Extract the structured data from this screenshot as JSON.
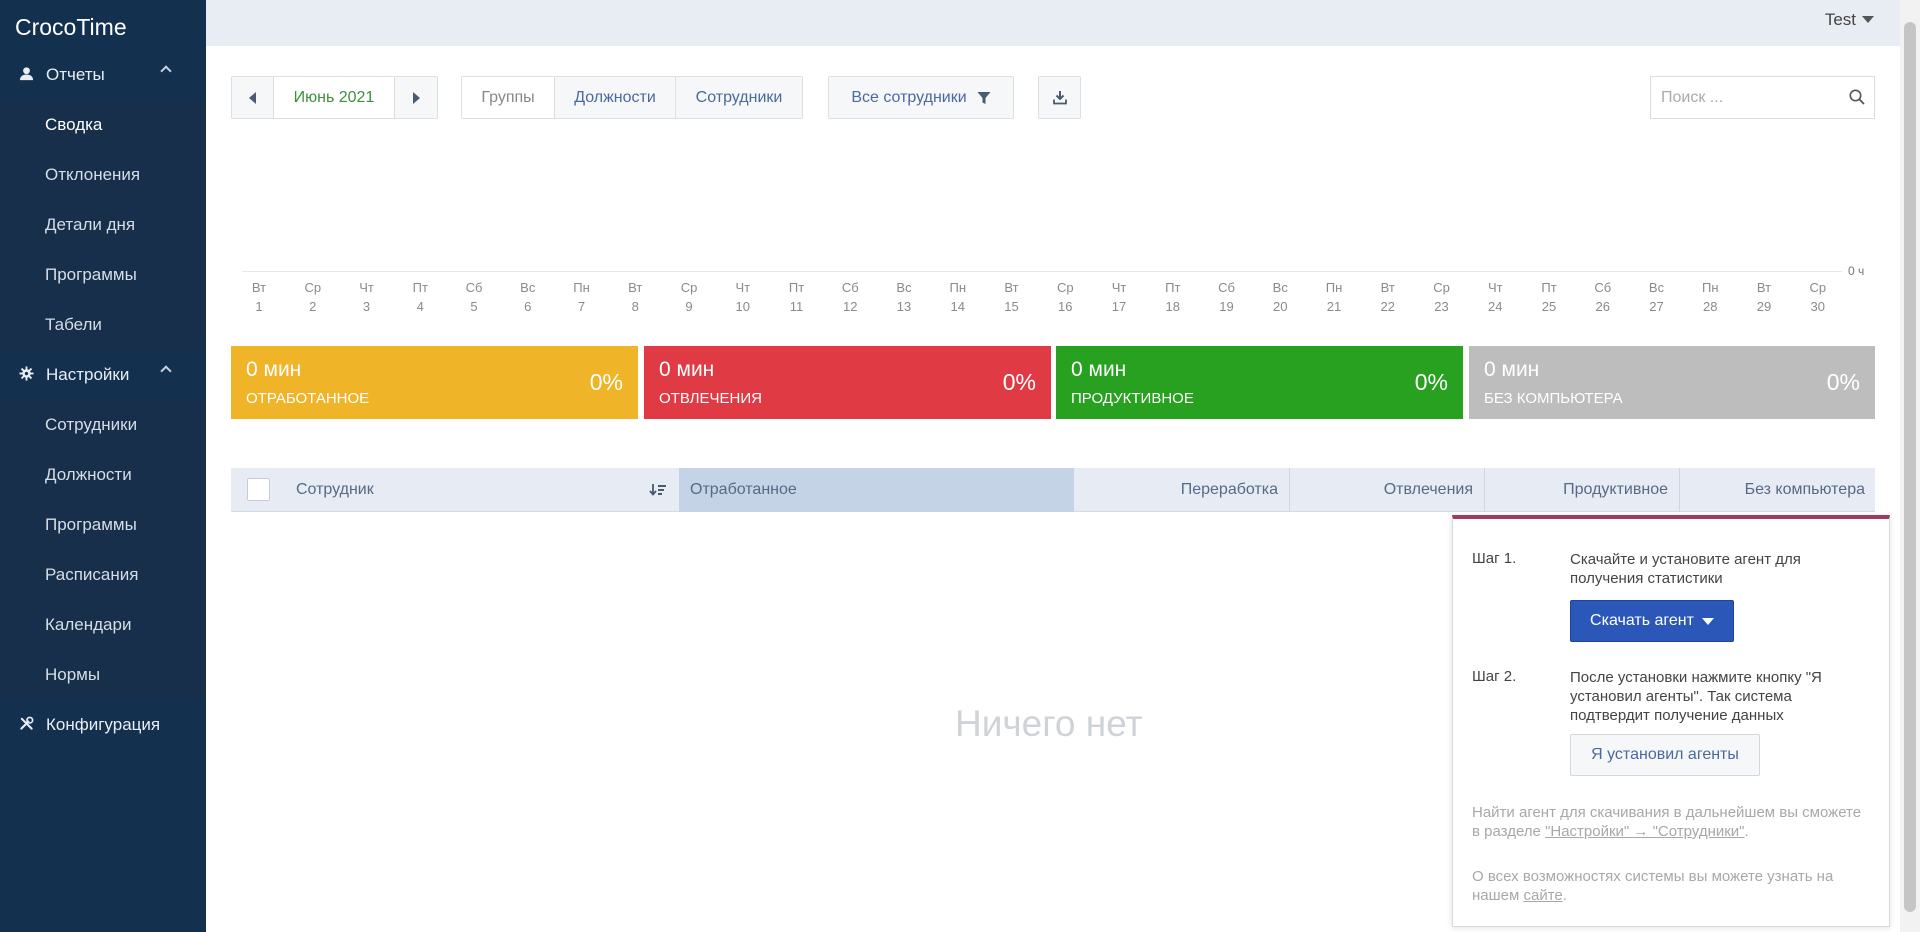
{
  "app": {
    "title": "CrocoTime"
  },
  "sidebar": {
    "reports": {
      "label": "Отчеты",
      "icon": "user-icon"
    },
    "report_items": [
      {
        "label": "Сводка",
        "active": true
      },
      {
        "label": "Отклонения"
      },
      {
        "label": "Детали дня"
      },
      {
        "label": "Программы"
      },
      {
        "label": "Табели"
      }
    ],
    "settings": {
      "label": "Настройки",
      "icon": "gear-icon"
    },
    "settings_items": [
      {
        "label": "Сотрудники"
      },
      {
        "label": "Должности"
      },
      {
        "label": "Программы"
      },
      {
        "label": "Расписания"
      },
      {
        "label": "Календари"
      },
      {
        "label": "Нормы"
      }
    ],
    "config": {
      "label": "Конфигурация",
      "icon": "tools-icon"
    }
  },
  "header": {
    "user": "Test"
  },
  "toolbar": {
    "month": "Июнь 2021",
    "view_groups": "Группы",
    "view_positions": "Должности",
    "view_employees": "Сотрудники",
    "filter": "Все сотрудники",
    "search_placeholder": "Поиск ..."
  },
  "timeline": {
    "zero_label": "0 ч",
    "days": [
      {
        "wd": "Вт",
        "d": "1"
      },
      {
        "wd": "Ср",
        "d": "2"
      },
      {
        "wd": "Чт",
        "d": "3"
      },
      {
        "wd": "Пт",
        "d": "4"
      },
      {
        "wd": "Сб",
        "d": "5"
      },
      {
        "wd": "Вс",
        "d": "6"
      },
      {
        "wd": "Пн",
        "d": "7"
      },
      {
        "wd": "Вт",
        "d": "8"
      },
      {
        "wd": "Ср",
        "d": "9"
      },
      {
        "wd": "Чт",
        "d": "10"
      },
      {
        "wd": "Пт",
        "d": "11"
      },
      {
        "wd": "Сб",
        "d": "12"
      },
      {
        "wd": "Вс",
        "d": "13"
      },
      {
        "wd": "Пн",
        "d": "14"
      },
      {
        "wd": "Вт",
        "d": "15"
      },
      {
        "wd": "Ср",
        "d": "16"
      },
      {
        "wd": "Чт",
        "d": "17"
      },
      {
        "wd": "Пт",
        "d": "18"
      },
      {
        "wd": "Сб",
        "d": "19"
      },
      {
        "wd": "Вс",
        "d": "20"
      },
      {
        "wd": "Пн",
        "d": "21"
      },
      {
        "wd": "Вт",
        "d": "22"
      },
      {
        "wd": "Ср",
        "d": "23"
      },
      {
        "wd": "Чт",
        "d": "24"
      },
      {
        "wd": "Пт",
        "d": "25"
      },
      {
        "wd": "Сб",
        "d": "26"
      },
      {
        "wd": "Вс",
        "d": "27"
      },
      {
        "wd": "Пн",
        "d": "28"
      },
      {
        "wd": "Вт",
        "d": "29"
      },
      {
        "wd": "Ср",
        "d": "30"
      }
    ]
  },
  "stats": [
    {
      "value": "0 мин",
      "label": "ОТРАБОТАННОЕ",
      "percent": "0%",
      "color": "#f0b429"
    },
    {
      "value": "0 мин",
      "label": "ОТВЛЕЧЕНИЯ",
      "percent": "0%",
      "color": "#e03a45"
    },
    {
      "value": "0 мин",
      "label": "ПРОДУКТИВНОЕ",
      "percent": "0%",
      "color": "#27a11f"
    },
    {
      "value": "0 мин",
      "label": "БЕЗ КОМПЬЮТЕРА",
      "percent": "0%",
      "color": "#bdbdbd"
    }
  ],
  "table": {
    "columns": {
      "employee": "Сотрудник",
      "worked": "Отработанное",
      "overtime": "Переработка",
      "distractions": "Отвлечения",
      "productive": "Продуктивное",
      "offline": "Без компьютера"
    },
    "empty": "Ничего нет"
  },
  "onboarding": {
    "step1_label": "Шаг 1.",
    "step1_text": "Скачайте и установите агент для получения статистики",
    "download_button": "Скачать агент",
    "step2_label": "Шаг 2.",
    "step2_text": "После установки нажмите кнопку \"Я установил агенты\". Так система подтвердит получение данных",
    "installed_button": "Я установил агенты",
    "note1_text": "Найти агент для скачивания в дальнейшем вы сможете в разделе ",
    "note1_link": "\"Настройки\" → \"Сотрудники\"",
    "note1_end": ".",
    "note2_text": "О всех возможностях системы вы можете узнать на нашем ",
    "note2_link": "сайте",
    "note2_end": "."
  },
  "colors": {
    "sidebar": "#13304f",
    "accent": "#2b58b8",
    "popup_border": "#a23a5c"
  }
}
